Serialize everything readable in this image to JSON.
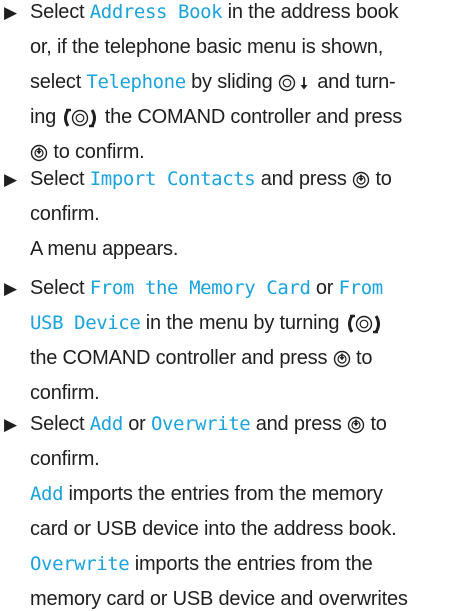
{
  "colors": {
    "text": "#1f1f1f",
    "command": "#1aa3dc"
  },
  "steps": [
    {
      "arrow": "▶",
      "lines": [
        [
          {
            "t": "text",
            "v": "Select "
          },
          {
            "t": "cmd",
            "v": "Address Book"
          },
          {
            "t": "text",
            "v": " in the address book"
          }
        ],
        [
          {
            "t": "text",
            "v": "or, if the telephone basic menu is shown,"
          }
        ],
        [
          {
            "t": "text",
            "v": "select "
          },
          {
            "t": "cmd",
            "v": "Telephone"
          },
          {
            "t": "text",
            "v": " by sliding "
          },
          {
            "t": "icon",
            "v": "slide-down-icon"
          },
          {
            "t": "text",
            "v": " and turn-"
          }
        ],
        [
          {
            "t": "text",
            "v": "ing "
          },
          {
            "t": "icon",
            "v": "turn-controller-icon"
          },
          {
            "t": "text",
            "v": " the COMAND controller and press"
          }
        ],
        [
          {
            "t": "icon",
            "v": "press-icon"
          },
          {
            "t": "text",
            "v": " to confirm."
          }
        ]
      ]
    },
    {
      "arrow": "▶",
      "lines": [
        [
          {
            "t": "text",
            "v": "Select "
          },
          {
            "t": "cmd",
            "v": "Import Contacts"
          },
          {
            "t": "text",
            "v": " and press "
          },
          {
            "t": "icon",
            "v": "press-icon"
          },
          {
            "t": "text",
            "v": " to"
          }
        ],
        [
          {
            "t": "text",
            "v": "confirm."
          }
        ],
        [
          {
            "t": "text",
            "v": "A menu appears."
          }
        ]
      ]
    },
    {
      "arrow": "▶",
      "lines": [
        [
          {
            "t": "text",
            "v": "Select "
          },
          {
            "t": "cmd",
            "v": "From the Memory Card"
          },
          {
            "t": "text",
            "v": " or "
          },
          {
            "t": "cmd",
            "v": "From"
          }
        ],
        [
          {
            "t": "cmd",
            "v": "USB Device"
          },
          {
            "t": "text",
            "v": " in the menu by turning "
          },
          {
            "t": "icon",
            "v": "turn-controller-icon"
          }
        ],
        [
          {
            "t": "text",
            "v": "the COMAND controller and press "
          },
          {
            "t": "icon",
            "v": "press-icon"
          },
          {
            "t": "text",
            "v": " to"
          }
        ],
        [
          {
            "t": "text",
            "v": "confirm."
          }
        ]
      ]
    },
    {
      "arrow": "▶",
      "lines": [
        [
          {
            "t": "text",
            "v": "Select "
          },
          {
            "t": "cmd",
            "v": "Add"
          },
          {
            "t": "text",
            "v": " or "
          },
          {
            "t": "cmd",
            "v": "Overwrite"
          },
          {
            "t": "text",
            "v": " and press "
          },
          {
            "t": "icon",
            "v": "press-icon"
          },
          {
            "t": "text",
            "v": " to"
          }
        ],
        [
          {
            "t": "text",
            "v": "confirm."
          }
        ],
        [
          {
            "t": "cmd",
            "v": "Add"
          },
          {
            "t": "text",
            "v": " imports the entries from the memory"
          }
        ],
        [
          {
            "t": "text",
            "v": "card or USB device into the address book."
          }
        ],
        [
          {
            "t": "cmd",
            "v": "Overwrite"
          },
          {
            "t": "text",
            "v": " imports the entries from the"
          }
        ],
        [
          {
            "t": "text",
            "v": "memory card or USB device and overwrites"
          }
        ]
      ]
    }
  ]
}
